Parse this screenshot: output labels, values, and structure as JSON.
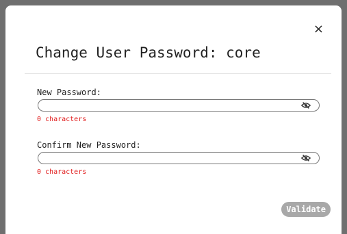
{
  "dialog": {
    "title": "Change User Password: core",
    "close_label": "×"
  },
  "new_password": {
    "label": "New Password:",
    "value": "",
    "counter": "0 characters"
  },
  "confirm_password": {
    "label": "Confirm New Password:",
    "value": "",
    "counter": "0 characters"
  },
  "actions": {
    "validate_label": "Validate"
  },
  "icons": {
    "visibility_toggle": "eye-slash-icon"
  },
  "colors": {
    "error_text": "#e11d1d",
    "button_disabled": "#a8a8a8"
  }
}
